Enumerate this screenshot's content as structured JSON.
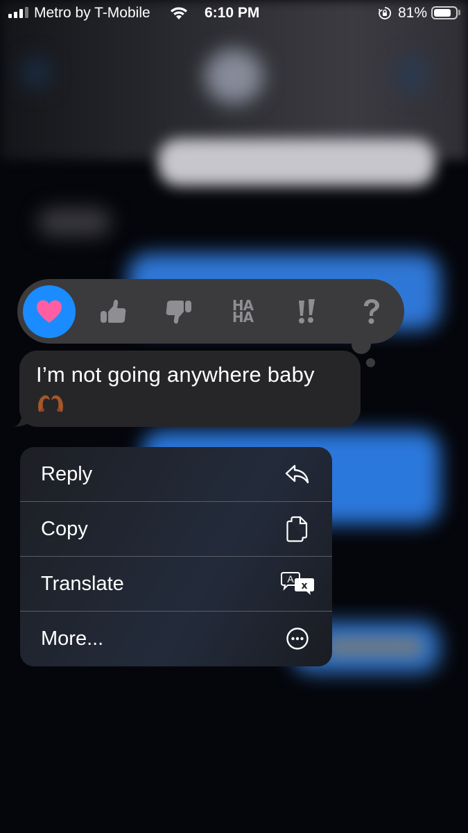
{
  "status_bar": {
    "carrier": "Metro by T-Mobile",
    "time": "6:10 PM",
    "battery_percent_label": "81%",
    "battery_level": 0.81,
    "signal_bars": 3,
    "signal_bars_total": 4,
    "icons": [
      "signal-icon",
      "wifi-icon",
      "orientation-lock-icon",
      "battery-icon"
    ]
  },
  "tapback": {
    "reactions": [
      {
        "name": "heart",
        "icon": "heart-icon",
        "selected": true
      },
      {
        "name": "thumbs-up",
        "icon": "thumbs-up-icon",
        "selected": false
      },
      {
        "name": "thumbs-down",
        "icon": "thumbs-down-icon",
        "selected": false
      },
      {
        "name": "haha",
        "icon": "haha-icon",
        "text_top": "HA",
        "text_bottom": "HA",
        "selected": false
      },
      {
        "name": "emphasize",
        "icon": "double-exclamation-icon",
        "selected": false
      },
      {
        "name": "question",
        "icon": "question-mark-icon",
        "selected": false
      }
    ],
    "colors": {
      "bar": "#3b3b3d",
      "selected_bg": "#1a8cff",
      "heart": "#ff5fa2",
      "inactive": "#8e8e93"
    }
  },
  "message": {
    "text": "I’m not going anywhere baby",
    "emoji": "🫶🏾",
    "emoji_icon": "heart-hands-emoji"
  },
  "context_menu": {
    "items": [
      {
        "label": "Reply",
        "icon": "reply-arrow-icon"
      },
      {
        "label": "Copy",
        "icon": "copy-documents-icon"
      },
      {
        "label": "Translate",
        "icon": "translate-icon"
      },
      {
        "label": "More...",
        "icon": "ellipsis-circle-icon"
      }
    ]
  }
}
